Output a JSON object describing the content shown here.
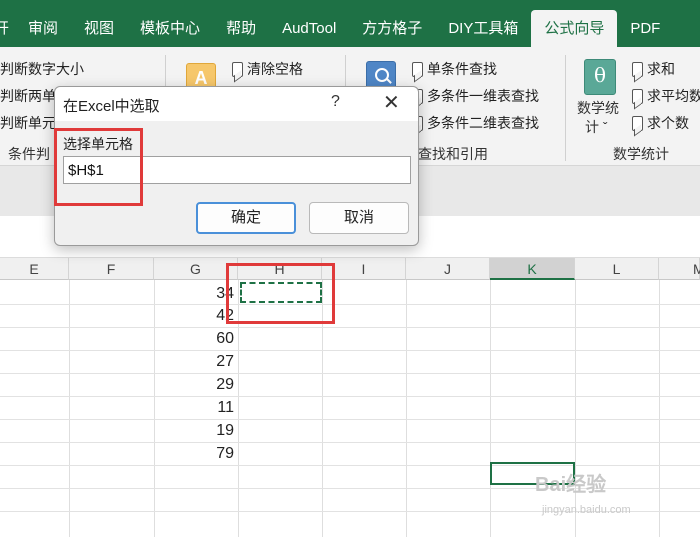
{
  "ribbon_tabs": [
    {
      "label": "开"
    },
    {
      "label": "审阅"
    },
    {
      "label": "视图"
    },
    {
      "label": "模板中心"
    },
    {
      "label": "帮助"
    },
    {
      "label": "AudTool"
    },
    {
      "label": "方方格子"
    },
    {
      "label": "DIY工具箱"
    },
    {
      "label": "公式向导",
      "active": true
    },
    {
      "label": "PDF"
    }
  ],
  "ribbon": {
    "condition_items": [
      "判断数字大小",
      "判断两单",
      "判断单元"
    ],
    "condition_label": "条件判",
    "text_item": "清除空格",
    "lookup_items": [
      "单条件查找",
      "多条件一维表查找",
      "多条件二维表查找"
    ],
    "lookup_label": "查找和引用",
    "stats_button": "数学统",
    "stats_button_line2": "计 ˇ",
    "stats_items": [
      "求和",
      "求平均数",
      "求个数"
    ],
    "stats_label": "数学统计"
  },
  "columns": [
    "E",
    "F",
    "G",
    "H",
    "I",
    "J",
    "K",
    "L",
    "M"
  ],
  "selected_column": "K",
  "g_values": [
    "34",
    "42",
    "60",
    "27",
    "29",
    "11",
    "19",
    "79"
  ],
  "dialog": {
    "title": "在Excel中选取",
    "help": "?",
    "close": "✕",
    "label": "选择单元格",
    "value": "$H$1",
    "ok": "确定",
    "cancel": "取消"
  },
  "watermark": {
    "line1": "Bai经验",
    "line2": "jingyan.baidu.com"
  },
  "colors": {
    "excel_green": "#1e7145",
    "annotation_red": "#e03a3a",
    "ribbon_bg": "#f3f3f3"
  }
}
